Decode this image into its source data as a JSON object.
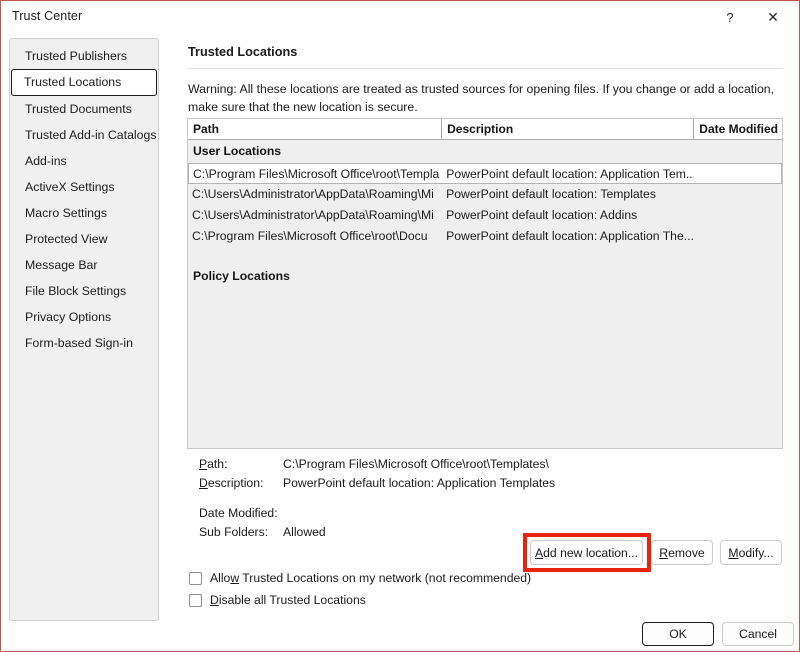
{
  "window": {
    "title": "Trust Center",
    "help_icon": "question-mark-icon",
    "close_icon": "close-icon",
    "border_color": "#c0584b"
  },
  "sidebar": {
    "items": [
      {
        "label": "Trusted Publishers",
        "selected": false
      },
      {
        "label": "Trusted Locations",
        "selected": true
      },
      {
        "label": "Trusted Documents",
        "selected": false
      },
      {
        "label": "Trusted Add-in Catalogs",
        "selected": false
      },
      {
        "label": "Add-ins",
        "selected": false
      },
      {
        "label": "ActiveX Settings",
        "selected": false
      },
      {
        "label": "Macro Settings",
        "selected": false
      },
      {
        "label": "Protected View",
        "selected": false
      },
      {
        "label": "Message Bar",
        "selected": false
      },
      {
        "label": "File Block Settings",
        "selected": false
      },
      {
        "label": "Privacy Options",
        "selected": false
      },
      {
        "label": "Form-based Sign-in",
        "selected": false
      }
    ]
  },
  "pane": {
    "heading": "Trusted Locations",
    "warning": "Warning: All these locations are treated as trusted sources for opening files.  If you change or add a location, make sure that the new location is secure."
  },
  "listview": {
    "columns": {
      "path": "Path",
      "description": "Description",
      "date_modified": "Date Modified"
    },
    "groups": [
      {
        "name": "User Locations"
      },
      {
        "name": "Policy Locations"
      }
    ],
    "rows": [
      {
        "path": "C:\\Program Files\\Microsoft Office\\root\\Templa",
        "description": "PowerPoint default location: Application Tem...",
        "date_modified": "",
        "selected": true
      },
      {
        "path": "C:\\Users\\Administrator\\AppData\\Roaming\\Mi",
        "description": "PowerPoint default location: Templates",
        "date_modified": "",
        "selected": false
      },
      {
        "path": "C:\\Users\\Administrator\\AppData\\Roaming\\Mi",
        "description": "PowerPoint default location: Addins",
        "date_modified": "",
        "selected": false
      },
      {
        "path": "C:\\Program Files\\Microsoft Office\\root\\Docu",
        "description": "PowerPoint default location: Application The...",
        "date_modified": "",
        "selected": false
      }
    ]
  },
  "details": {
    "path_label": "Path:",
    "path_value": "C:\\Program Files\\Microsoft Office\\root\\Templates\\",
    "description_label": "Description:",
    "description_value": "PowerPoint default location: Application Templates",
    "date_modified_label": "Date Modified:",
    "date_modified_value": "",
    "sub_folders_label": "Sub Folders:",
    "sub_folders_value": "Allowed"
  },
  "actions": {
    "add_new_location": "Add new location...",
    "remove": "Remove",
    "modify": "Modify...",
    "highlight_color": "#e8250c"
  },
  "checkboxes": [
    {
      "label": "Allow Trusted Locations on my network (not recommended)",
      "checked": false
    },
    {
      "label": "Disable all Trusted Locations",
      "checked": false
    }
  ],
  "footer": {
    "ok": "OK",
    "cancel": "Cancel"
  }
}
